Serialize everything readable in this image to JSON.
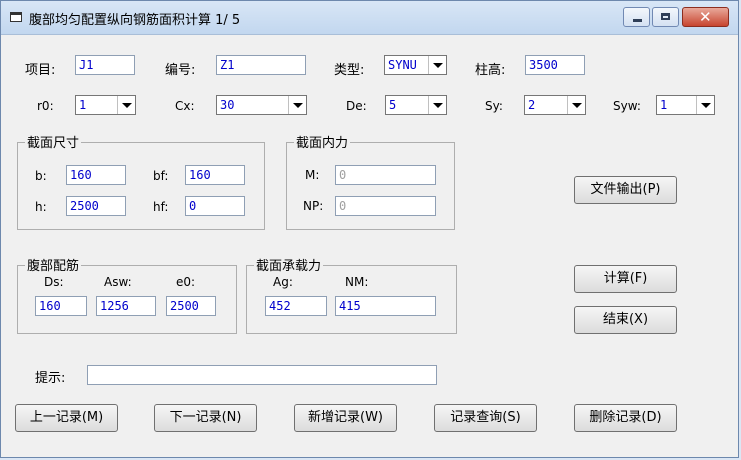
{
  "window": {
    "title": "腹部均匀配置纵向钢筋面积计算 1/ 5"
  },
  "top_fields": {
    "project_label": "项目:",
    "project_value": "J1",
    "number_label": "编号:",
    "number_value": "Z1",
    "type_label": "类型:",
    "type_value": "SYNU",
    "height_label": "柱高:",
    "height_value": "3500"
  },
  "selects": {
    "r0_label": "r0:",
    "r0_value": "1",
    "cx_label": "Cx:",
    "cx_value": "30",
    "de_label": "De:",
    "de_value": "5",
    "sy_label": "Sy:",
    "sy_value": "2",
    "syw_label": "Syw:",
    "syw_value": "1"
  },
  "section_size": {
    "title": "截面尺寸",
    "b_label": "b:",
    "b_value": "160",
    "bf_label": "bf:",
    "bf_value": "160",
    "h_label": "h:",
    "h_value": "2500",
    "hf_label": "hf:",
    "hf_value": "0"
  },
  "internal_force": {
    "title": "截面内力",
    "m_label": "M:",
    "m_value": "0",
    "np_label": "NP:",
    "np_value": "0"
  },
  "web_rebar": {
    "title": "腹部配筋",
    "ds_label": "Ds:",
    "ds_value": "160",
    "asw_label": "Asw:",
    "asw_value": "1256",
    "e0_label": "e0:",
    "e0_value": "2500"
  },
  "capacity": {
    "title": "截面承载力",
    "ag_label": "Ag:",
    "ag_value": "452",
    "nm_label": "NM:",
    "nm_value": "415"
  },
  "side_buttons": {
    "export": "文件输出(P)",
    "calc": "计算(F)",
    "finish": "结束(X)"
  },
  "hint": {
    "label": "提示:",
    "value": ""
  },
  "bottom_buttons": {
    "prev": "上一记录(M)",
    "next": "下一记录(N)",
    "add": "新增记录(W)",
    "query": "记录查询(S)",
    "delete": "删除记录(D)"
  }
}
